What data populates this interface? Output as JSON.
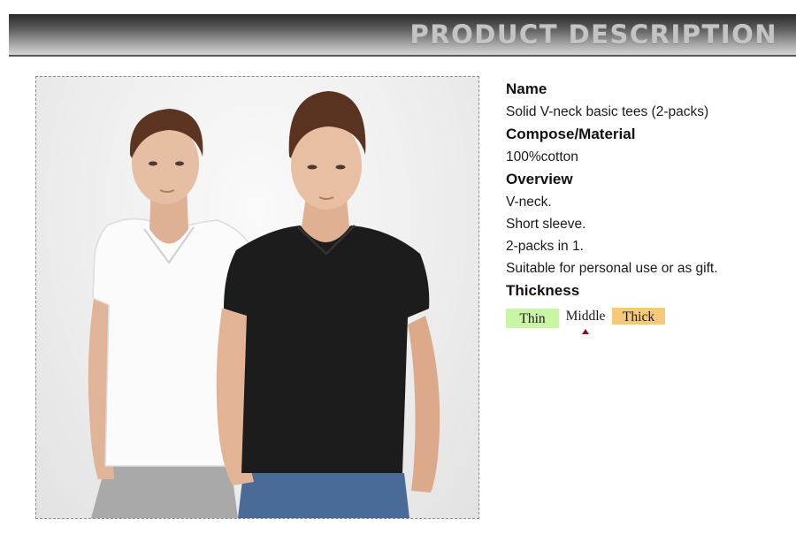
{
  "header": {
    "title": "PRODUCT DESCRIPTION"
  },
  "spec": {
    "name_heading": "Name",
    "name_value": "Solid V-neck basic tees (2-packs)",
    "material_heading": "Compose/Material",
    "material_value": "100%cotton",
    "overview_heading": "Overview",
    "overview_lines": [
      "V-neck.",
      "Short sleeve.",
      "2-packs in 1.",
      "Suitable for personal use or as gift."
    ],
    "thickness_heading": "Thickness"
  },
  "thickness": {
    "options": [
      "Thin",
      "Middle",
      "Thick"
    ],
    "selected": "Middle",
    "colors": {
      "thin": "#c9f5a5",
      "middle": "#ffffff",
      "thick": "#f6c879",
      "indicator": "#8b0d1d"
    }
  },
  "photo": {
    "subject": "two models wearing V-neck tees",
    "shirt_colors": [
      "white",
      "black"
    ]
  }
}
